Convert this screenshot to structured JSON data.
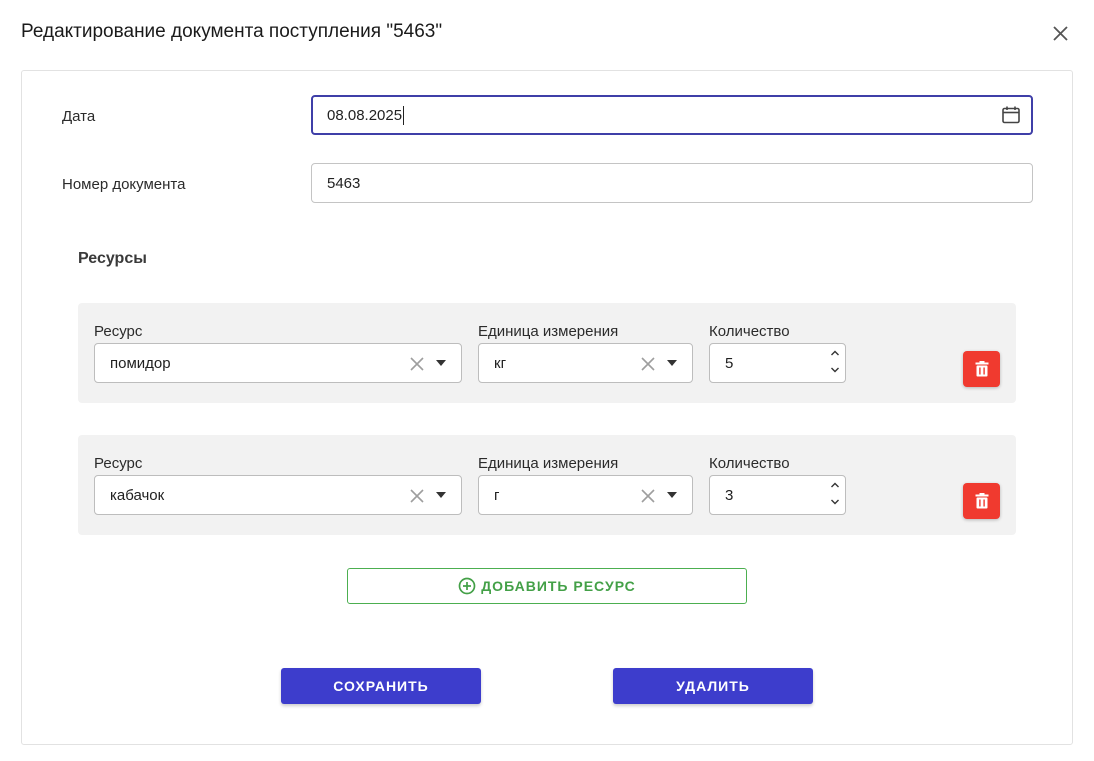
{
  "dialog": {
    "title": "Редактирование документа поступления \"5463\"",
    "close_icon": "close-icon"
  },
  "form": {
    "date_label": "Дата",
    "date_value": "08.08.2025",
    "calendar_icon": "calendar-icon",
    "doc_number_label": "Номер документа",
    "doc_number_value": "5463"
  },
  "resources": {
    "title": "Ресурсы",
    "rows": [
      {
        "resource_label": "Ресурс",
        "resource_value": "помидор",
        "unit_label": "Единица измерения",
        "unit_value": "кг",
        "quantity_label": "Количество",
        "quantity_value": "5"
      },
      {
        "resource_label": "Ресурс",
        "resource_value": "кабачок",
        "unit_label": "Единица измерения",
        "unit_value": "г",
        "quantity_label": "Количество",
        "quantity_value": "3"
      }
    ],
    "add_label": "ДОБАВИТЬ РЕСУРС",
    "add_icon": "plus-circle-icon",
    "delete_icon": "trash-icon"
  },
  "actions": {
    "save_label": "СОХРАНИТЬ",
    "delete_label": "УДАЛИТЬ"
  },
  "colors": {
    "primary": "#3d3dcc",
    "focus_border": "#3f3fa8",
    "danger": "#f03a2f",
    "success": "#43a047",
    "row_bg": "#f2f2f2"
  }
}
